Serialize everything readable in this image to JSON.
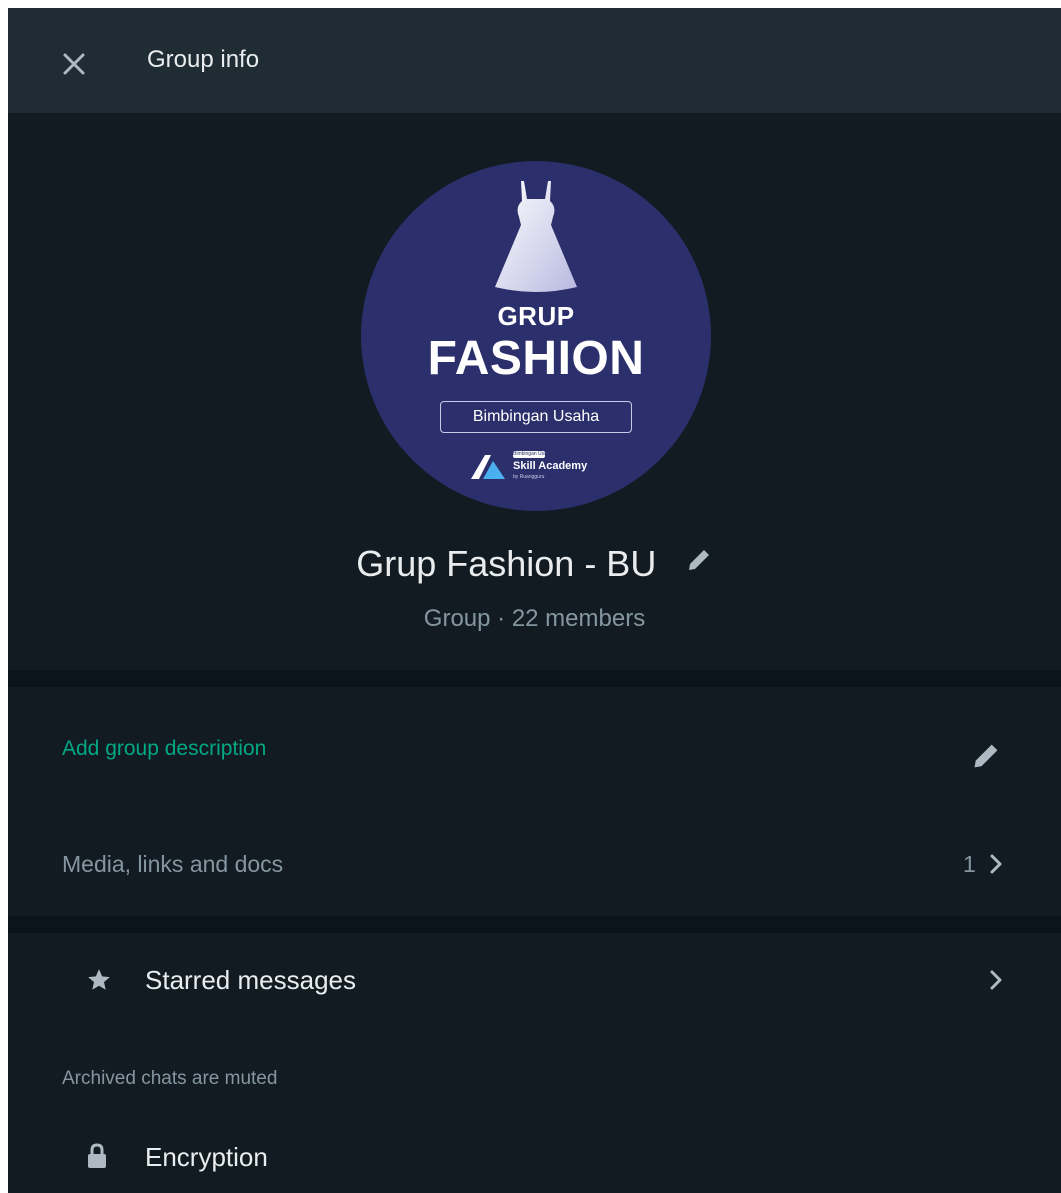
{
  "header": {
    "title": "Group info",
    "close_icon": "close-icon"
  },
  "profile": {
    "avatar": {
      "line1": "GRUP",
      "line2": "FASHION",
      "tag": "Bimbingan Usaha",
      "brand_top": "Bimbingan Usaha",
      "brand": "Skill Academy",
      "brand_sub": "by Ruangguru",
      "background": "#2b2f6b"
    },
    "name": "Grup Fashion - BU",
    "meta": "Group · 22 members"
  },
  "description": {
    "add_label": "Add group description",
    "accent": "#00a884"
  },
  "media": {
    "label": "Media, links and docs",
    "count": "1"
  },
  "actions": {
    "starred_label": "Starred messages",
    "archived_note": "Archived chats are muted",
    "encryption_label": "Encryption"
  },
  "colors": {
    "panel_bg": "#0b141a",
    "header_bg": "#202c33",
    "section_bg": "#111b21",
    "primary_text": "#e9edef",
    "secondary_text": "#8696a0"
  }
}
